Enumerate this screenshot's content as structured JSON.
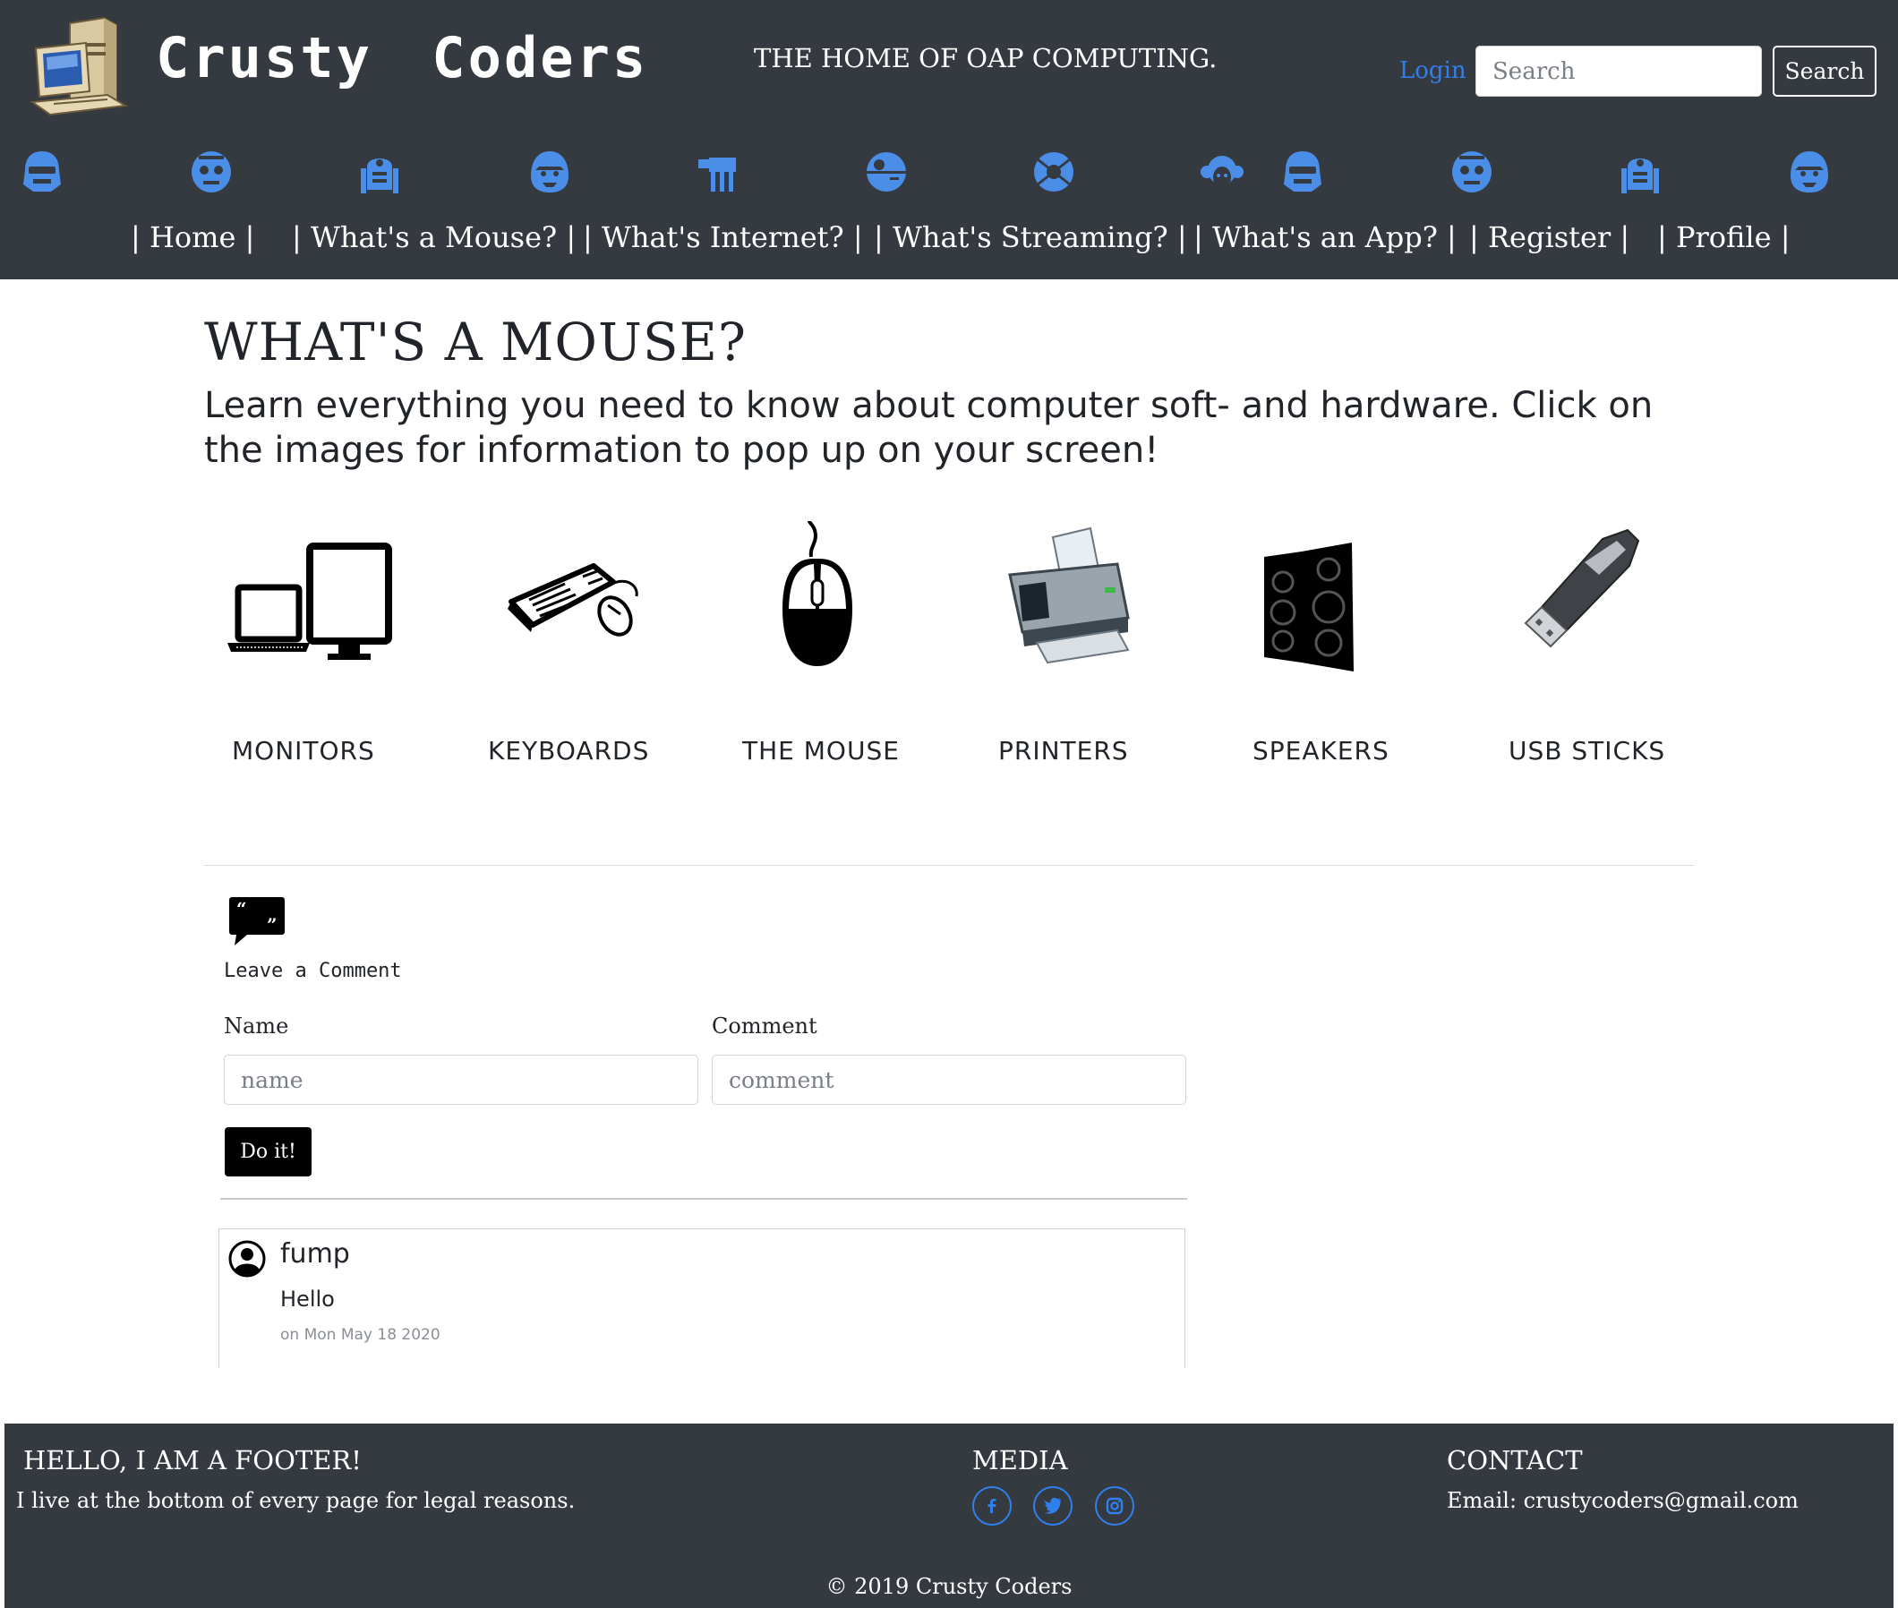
{
  "header": {
    "brand": "Crusty Coders",
    "tagline": "THE HOME OF OAP COMPUTING.",
    "login_label": "Login",
    "search_placeholder": "Search",
    "search_button": "Search",
    "nav_icons": [
      "stormtrooper-icon",
      "c3po-icon",
      "r2d2-icon",
      "chewbacca-icon",
      "at-at-icon",
      "death-star-icon",
      "tie-fighter-icon",
      "leia-icon",
      "stormtrooper-icon",
      "c3po-icon",
      "r2d2-icon",
      "chewbacca-icon"
    ],
    "nav": [
      {
        "label": "| Home |"
      },
      {
        "label": "| What's a Mouse? |"
      },
      {
        "label": "| What's Internet? |"
      },
      {
        "label": "| What's Streaming? |"
      },
      {
        "label": "| What's an App? |"
      },
      {
        "label": "| Register |"
      },
      {
        "label": "| Profile |"
      }
    ]
  },
  "main": {
    "title": "WHAT'S A MOUSE?",
    "lead": "Learn everything you need to know about computer soft- and hardware. Click on the images for information to pop up on your screen!",
    "devices": [
      {
        "label": "MONITORS",
        "icon": "monitors-icon"
      },
      {
        "label": "KEYBOARDS",
        "icon": "keyboard-icon"
      },
      {
        "label": "THE MOUSE",
        "icon": "mouse-icon"
      },
      {
        "label": "PRINTERS",
        "icon": "printer-icon"
      },
      {
        "label": "SPEAKERS",
        "icon": "speakers-icon"
      },
      {
        "label": "USB STICKS",
        "icon": "usb-stick-icon"
      }
    ]
  },
  "comment_form": {
    "heading": "Leave a Comment",
    "name_label": "Name",
    "name_placeholder": "name",
    "comment_label": "Comment",
    "comment_placeholder": "comment",
    "submit_label": "Do it!"
  },
  "comments": [
    {
      "author": "fump",
      "text": "Hello",
      "date": "on Mon May 18 2020"
    }
  ],
  "footer": {
    "about_heading": "HELLO, I AM A FOOTER!",
    "about_text": "I live at the bottom of every page for legal reasons.",
    "media_heading": "MEDIA",
    "social_icons": [
      "facebook-icon",
      "twitter-icon",
      "instagram-icon"
    ],
    "contact_heading": "CONTACT",
    "contact_text": "Email: crustycoders@gmail.com",
    "copyright": "© 2019 Crusty Coders"
  },
  "colors": {
    "header_bg": "#343a40",
    "accent_blue": "#2f80ed",
    "nav_icon_blue": "#4a8ee8",
    "footer_bg": "#343a40",
    "button_black": "#000000"
  }
}
